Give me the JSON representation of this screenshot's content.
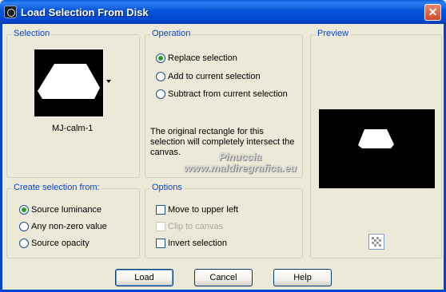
{
  "window": {
    "title": "Load Selection From Disk",
    "close_symbol": "✕"
  },
  "selection_group": {
    "title": "Selection",
    "name": "MJ-calm-1"
  },
  "operation_group": {
    "title": "Operation",
    "options": [
      "Replace selection",
      "Add to current selection",
      "Subtract from current selection"
    ],
    "selected": "Replace selection",
    "info": "The original rectangle for this selection will completely intersect the canvas."
  },
  "preview_group": {
    "title": "Preview"
  },
  "create_group": {
    "title": "Create selection from:",
    "options": [
      "Source luminance",
      "Any non-zero value",
      "Source opacity"
    ],
    "selected": "Source luminance"
  },
  "options_group": {
    "title": "Options",
    "checkboxes": [
      {
        "label": "Move to upper left",
        "checked": false,
        "disabled": false
      },
      {
        "label": "Clip to canvas",
        "checked": false,
        "disabled": true
      },
      {
        "label": "Invert selection",
        "checked": false,
        "disabled": false
      }
    ]
  },
  "buttons": {
    "load": "Load",
    "cancel": "Cancel",
    "help": "Help"
  },
  "watermark": {
    "line1": "Pinuccia",
    "line2": "www.maldiregrafica.eu"
  },
  "icons": [
    "app-icon",
    "close-icon",
    "dropdown-arrow-icon",
    "checkerboard-icon"
  ],
  "colors": {
    "title_bar": "#0047cc",
    "group_title": "#0046d5",
    "radio_dot": "#21a121",
    "dialog_bg": "#ece9d8"
  }
}
